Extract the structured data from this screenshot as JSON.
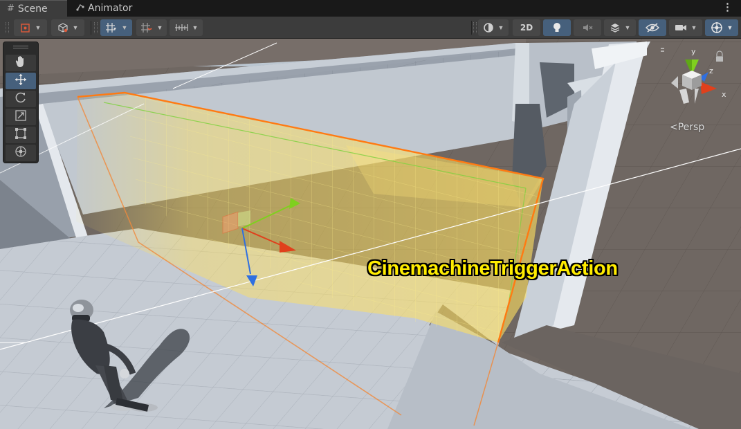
{
  "tabs": [
    {
      "label": "Scene",
      "icon": "hash-icon",
      "active": true
    },
    {
      "label": "Animator",
      "icon": "animator-icon",
      "active": false
    }
  ],
  "toolbar": {
    "mode_2d_label": "2D"
  },
  "viewport": {
    "object_label": "CinemachineTriggerAction",
    "projection_label": "Persp",
    "axis_labels": {
      "y": "y",
      "z": "z",
      "x": "x"
    }
  },
  "tools": [
    {
      "name": "hand-tool",
      "icon": "hand-icon",
      "active": false
    },
    {
      "name": "move-tool",
      "icon": "move-icon",
      "active": true
    },
    {
      "name": "rotate-tool",
      "icon": "rotate-icon",
      "active": false
    },
    {
      "name": "scale-tool",
      "icon": "scale-icon",
      "active": false
    },
    {
      "name": "rect-tool",
      "icon": "rect-icon",
      "active": false
    },
    {
      "name": "transform-tool",
      "icon": "transform-icon",
      "active": false
    }
  ],
  "colors": {
    "editor_bg": "#3c3c3c",
    "active_blue": "#46607c",
    "trigger_fill": "#ffe060",
    "trigger_outline": "#ff7a12",
    "label_yellow": "#ffec00",
    "axis_x": "#e0401c",
    "axis_y": "#7fd01e",
    "axis_z": "#2f6fe0"
  }
}
